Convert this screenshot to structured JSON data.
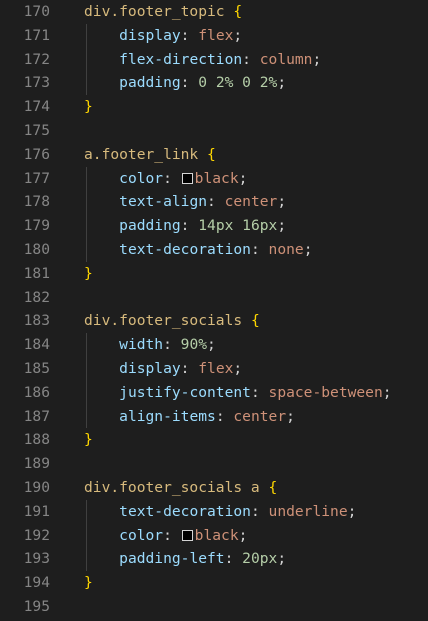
{
  "editor": {
    "lines": [
      {
        "number": "170",
        "tokens": [
          {
            "t": "div.footer_topic",
            "c": "sel"
          },
          {
            "t": " ",
            "c": "punc"
          },
          {
            "t": "{",
            "c": "brace"
          }
        ]
      },
      {
        "number": "171",
        "tokens": [
          {
            "t": "    "
          },
          {
            "t": "display",
            "c": "prop"
          },
          {
            "t": ": ",
            "c": "punc"
          },
          {
            "t": "flex",
            "c": "val"
          },
          {
            "t": ";",
            "c": "punc"
          }
        ]
      },
      {
        "number": "172",
        "tokens": [
          {
            "t": "    "
          },
          {
            "t": "flex-direction",
            "c": "prop"
          },
          {
            "t": ": ",
            "c": "punc"
          },
          {
            "t": "column",
            "c": "val"
          },
          {
            "t": ";",
            "c": "punc"
          }
        ]
      },
      {
        "number": "173",
        "tokens": [
          {
            "t": "    "
          },
          {
            "t": "padding",
            "c": "prop"
          },
          {
            "t": ": ",
            "c": "punc"
          },
          {
            "t": "0 2% 0 2%",
            "c": "num"
          },
          {
            "t": ";",
            "c": "punc"
          }
        ]
      },
      {
        "number": "174",
        "tokens": [
          {
            "t": "}",
            "c": "brace"
          }
        ]
      },
      {
        "number": "175",
        "tokens": []
      },
      {
        "number": "176",
        "tokens": [
          {
            "t": "a.footer_link",
            "c": "sel"
          },
          {
            "t": " ",
            "c": "punc"
          },
          {
            "t": "{",
            "c": "brace"
          }
        ]
      },
      {
        "number": "177",
        "tokens": [
          {
            "t": "    "
          },
          {
            "t": "color",
            "c": "prop"
          },
          {
            "t": ": ",
            "c": "punc"
          },
          {
            "swatch": "#000000"
          },
          {
            "t": "black",
            "c": "val"
          },
          {
            "t": ";",
            "c": "punc"
          }
        ]
      },
      {
        "number": "178",
        "tokens": [
          {
            "t": "    "
          },
          {
            "t": "text-align",
            "c": "prop"
          },
          {
            "t": ": ",
            "c": "punc"
          },
          {
            "t": "center",
            "c": "val"
          },
          {
            "t": ";",
            "c": "punc"
          }
        ]
      },
      {
        "number": "179",
        "tokens": [
          {
            "t": "    "
          },
          {
            "t": "padding",
            "c": "prop"
          },
          {
            "t": ": ",
            "c": "punc"
          },
          {
            "t": "14px 16px",
            "c": "num"
          },
          {
            "t": ";",
            "c": "punc"
          }
        ]
      },
      {
        "number": "180",
        "tokens": [
          {
            "t": "    "
          },
          {
            "t": "text-decoration",
            "c": "prop"
          },
          {
            "t": ": ",
            "c": "punc"
          },
          {
            "t": "none",
            "c": "val"
          },
          {
            "t": ";",
            "c": "punc"
          }
        ]
      },
      {
        "number": "181",
        "tokens": [
          {
            "t": "}",
            "c": "brace"
          }
        ]
      },
      {
        "number": "182",
        "tokens": []
      },
      {
        "number": "183",
        "tokens": [
          {
            "t": "div.footer_socials",
            "c": "sel"
          },
          {
            "t": " ",
            "c": "punc"
          },
          {
            "t": "{",
            "c": "brace"
          }
        ]
      },
      {
        "number": "184",
        "tokens": [
          {
            "t": "    "
          },
          {
            "t": "width",
            "c": "prop"
          },
          {
            "t": ": ",
            "c": "punc"
          },
          {
            "t": "90%",
            "c": "num"
          },
          {
            "t": ";",
            "c": "punc"
          }
        ]
      },
      {
        "number": "185",
        "tokens": [
          {
            "t": "    "
          },
          {
            "t": "display",
            "c": "prop"
          },
          {
            "t": ": ",
            "c": "punc"
          },
          {
            "t": "flex",
            "c": "val"
          },
          {
            "t": ";",
            "c": "punc"
          }
        ]
      },
      {
        "number": "186",
        "tokens": [
          {
            "t": "    "
          },
          {
            "t": "justify-content",
            "c": "prop"
          },
          {
            "t": ": ",
            "c": "punc"
          },
          {
            "t": "space-between",
            "c": "val"
          },
          {
            "t": ";",
            "c": "punc"
          }
        ]
      },
      {
        "number": "187",
        "tokens": [
          {
            "t": "    "
          },
          {
            "t": "align-items",
            "c": "prop"
          },
          {
            "t": ": ",
            "c": "punc"
          },
          {
            "t": "center",
            "c": "val"
          },
          {
            "t": ";",
            "c": "punc"
          }
        ]
      },
      {
        "number": "188",
        "tokens": [
          {
            "t": "}",
            "c": "brace"
          }
        ]
      },
      {
        "number": "189",
        "tokens": []
      },
      {
        "number": "190",
        "tokens": [
          {
            "t": "div.footer_socials a",
            "c": "sel"
          },
          {
            "t": " ",
            "c": "punc"
          },
          {
            "t": "{",
            "c": "brace"
          }
        ]
      },
      {
        "number": "191",
        "tokens": [
          {
            "t": "    "
          },
          {
            "t": "text-decoration",
            "c": "prop"
          },
          {
            "t": ": ",
            "c": "punc"
          },
          {
            "t": "underline",
            "c": "val"
          },
          {
            "t": ";",
            "c": "punc"
          }
        ]
      },
      {
        "number": "192",
        "tokens": [
          {
            "t": "    "
          },
          {
            "t": "color",
            "c": "prop"
          },
          {
            "t": ": ",
            "c": "punc"
          },
          {
            "swatch": "#000000"
          },
          {
            "t": "black",
            "c": "val"
          },
          {
            "t": ";",
            "c": "punc"
          }
        ]
      },
      {
        "number": "193",
        "tokens": [
          {
            "t": "    "
          },
          {
            "t": "padding-left",
            "c": "prop"
          },
          {
            "t": ": ",
            "c": "punc"
          },
          {
            "t": "20px",
            "c": "num"
          },
          {
            "t": ";",
            "c": "punc"
          }
        ]
      },
      {
        "number": "194",
        "tokens": [
          {
            "t": "}",
            "c": "brace"
          }
        ]
      },
      {
        "number": "195",
        "tokens": []
      }
    ],
    "colors": {
      "background": "#1e1e1e",
      "line_number": "#858585",
      "selector": "#d7ba7d",
      "brace": "#ffd700",
      "property": "#9cdcfe",
      "string_value": "#ce9178",
      "numeric_value": "#b5cea8",
      "punctuation": "#d4d4d4"
    }
  }
}
